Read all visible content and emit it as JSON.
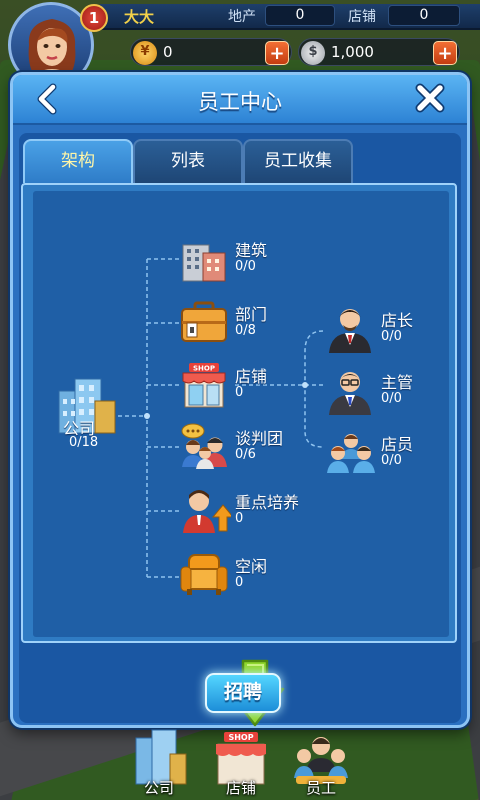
{
  "hud": {
    "level": "1",
    "player_name": "大大",
    "property_label": "地产",
    "property_value": "0",
    "shops_label": "店铺",
    "shops_value": "0",
    "gold_value": "0",
    "cash_value": "1,000",
    "plus_symbol": "+"
  },
  "dialog": {
    "title": "员工中心",
    "tabs": [
      "架构",
      "列表",
      "员工收集"
    ],
    "active_tab": 0
  },
  "org": {
    "company": {
      "label": "公司",
      "count": "0/18"
    },
    "departments": [
      {
        "label": "建筑",
        "count": "0/0",
        "icon": "building-icon"
      },
      {
        "label": "部门",
        "count": "0/8",
        "icon": "briefcase-icon"
      },
      {
        "label": "店铺",
        "count": "0",
        "icon": "shop-icon",
        "sign": "SHOP"
      },
      {
        "label": "谈判团",
        "count": "0/6",
        "icon": "negotiation-team-icon"
      },
      {
        "label": "重点培养",
        "count": "0",
        "icon": "training-icon"
      },
      {
        "label": "空闲",
        "count": "0",
        "icon": "armchair-icon"
      }
    ],
    "shop_roles": [
      {
        "label": "店长",
        "count": "0/0",
        "icon": "shop-manager-icon"
      },
      {
        "label": "主管",
        "count": "0/0",
        "icon": "supervisor-icon"
      },
      {
        "label": "店员",
        "count": "0/0",
        "icon": "clerk-icon"
      }
    ]
  },
  "recruit_label": "招聘",
  "dock": [
    {
      "label": "公司",
      "icon": "company-icon"
    },
    {
      "label": "店铺",
      "icon": "shop-icon",
      "sign": "SHOP"
    },
    {
      "label": "员工",
      "icon": "staff-icon"
    }
  ],
  "colors": {
    "dialog_blue": "#2a70c0",
    "panel_blue": "#1f5fa6",
    "accent_yellow": "#fff6a8",
    "plus_orange": "#e35523",
    "recruit_cyan": "#1d8ed8",
    "arrow_green": "#8fd62a"
  }
}
